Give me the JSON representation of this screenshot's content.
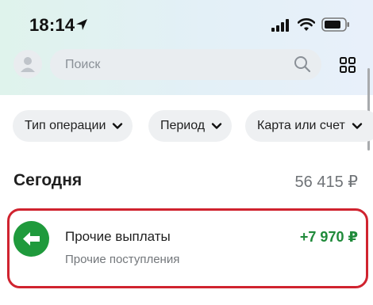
{
  "status_bar": {
    "time": "18:14",
    "icons": [
      "location-arrow-icon",
      "cellular-signal-icon",
      "wifi-icon",
      "battery-icon"
    ]
  },
  "header": {
    "avatar_icon": "user-avatar-icon",
    "search_placeholder": "Поиск",
    "search_icon": "search-icon",
    "menu_icon": "grid-menu-icon"
  },
  "filters": [
    {
      "label": "Тип операции",
      "icon": "chevron-down-icon"
    },
    {
      "label": "Период",
      "icon": "chevron-down-icon"
    },
    {
      "label": "Карта или счет",
      "icon": "chevron-down-icon"
    }
  ],
  "section": {
    "title": "Сегодня",
    "total": "56 415 ₽"
  },
  "operations": [
    {
      "title": "Прочие выплаты",
      "subtitle": "Прочие поступления",
      "amount": "+7 970 ₽",
      "icon": "arrow-left-icon",
      "icon_color": "#1f9a3c",
      "amount_color": "#1f8a3a"
    }
  ],
  "colors": {
    "highlight_border": "#d0232f",
    "chip_bg": "#eef0f2",
    "search_bg": "#e9edf0"
  }
}
